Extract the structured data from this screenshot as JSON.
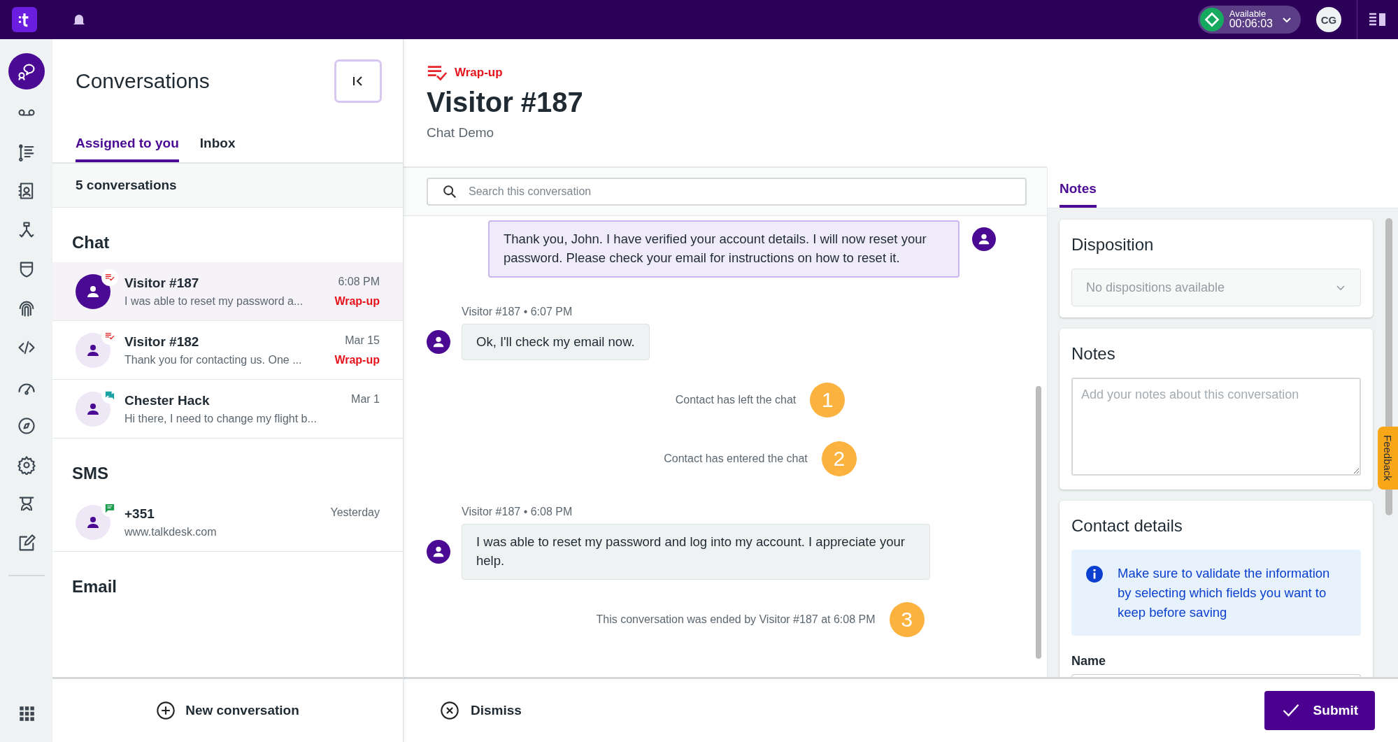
{
  "top_bar": {
    "status": {
      "label": "Available",
      "timer": "00:06:03"
    },
    "user_initials": "CG"
  },
  "rail": {
    "items": [
      {
        "kind": "conversations",
        "selected": true
      },
      {
        "kind": "voicemail",
        "selected": false
      },
      {
        "kind": "list",
        "selected": false
      },
      {
        "kind": "contacts",
        "selected": false
      },
      {
        "kind": "flow",
        "selected": false
      },
      {
        "kind": "shield",
        "selected": false
      },
      {
        "kind": "fingerprint",
        "selected": false
      },
      {
        "kind": "code",
        "selected": false
      },
      {
        "kind": "gauge",
        "selected": false
      },
      {
        "kind": "compass",
        "selected": false
      },
      {
        "kind": "gear",
        "selected": false
      },
      {
        "kind": "agent",
        "selected": false
      },
      {
        "kind": "edit",
        "selected": false
      }
    ]
  },
  "conversations": {
    "title": "Conversations",
    "tabs": [
      {
        "label": "Assigned to you",
        "selected": true
      },
      {
        "label": "Inbox",
        "selected": false
      }
    ],
    "count": "5 conversations",
    "groups": [
      {
        "title": "Chat",
        "items": [
          {
            "name": "Visitor #187",
            "preview": "I was able to reset my password a...",
            "time": "6:08 PM",
            "status": "Wrap-up",
            "kind": "wrapup",
            "selected": true
          },
          {
            "name": "Visitor #182",
            "preview": "Thank you for contacting us. One ...",
            "time": "Mar 15",
            "status": "Wrap-up",
            "kind": "wrapup",
            "selected": false
          },
          {
            "name": "Chester Hack",
            "preview": "Hi there, I need to change my flight b...",
            "time": "Mar 1",
            "kind": "chat",
            "selected": false
          }
        ]
      },
      {
        "title": "SMS",
        "items": [
          {
            "name": "+351",
            "preview": "www.talkdesk.com",
            "time": "Yesterday",
            "kind": "sms",
            "selected": false
          }
        ]
      },
      {
        "title": "Email"
      }
    ],
    "new_button": "New conversation"
  },
  "header": {
    "status": "Wrap-up",
    "title": "Visitor #187",
    "subtitle": "Chat Demo"
  },
  "chat": {
    "search": {
      "placeholder": "Search this conversation"
    },
    "messages": [
      {
        "kind": "agent",
        "text": "Thank you, John. I have verified your account details. I will now reset your password. Please check your email for instructions on how to reset it."
      },
      {
        "kind": "visitor",
        "meta": "Visitor #187 • 6:07 PM",
        "text": "Ok, I'll check my email now."
      },
      {
        "kind": "event",
        "text": "Contact has left the chat",
        "marker": "1"
      },
      {
        "kind": "event",
        "text": "Contact has entered the chat",
        "marker": "2"
      },
      {
        "kind": "visitor",
        "meta": "Visitor #187 • 6:08 PM",
        "text": "I was able to reset my password and log into my account. I appreciate your help."
      },
      {
        "kind": "event",
        "text": "This conversation was ended by Visitor #187 at 6:08 PM",
        "marker": "3"
      }
    ]
  },
  "notes_panel": {
    "tabs": [
      {
        "label": "Notes",
        "selected": true
      }
    ],
    "disposition": {
      "title": "Disposition",
      "placeholder": "No dispositions available",
      "disabled": true
    },
    "notes": {
      "title": "Notes",
      "placeholder": "Add your notes about this conversation"
    },
    "contact": {
      "title": "Contact details",
      "info": "Make sure to validate the information by selecting which fields you want to keep before saving",
      "field_label": "Name"
    }
  },
  "feedback_tab": "Feedback",
  "footer": {
    "dismiss": "Dismiss",
    "submit": "Submit"
  }
}
